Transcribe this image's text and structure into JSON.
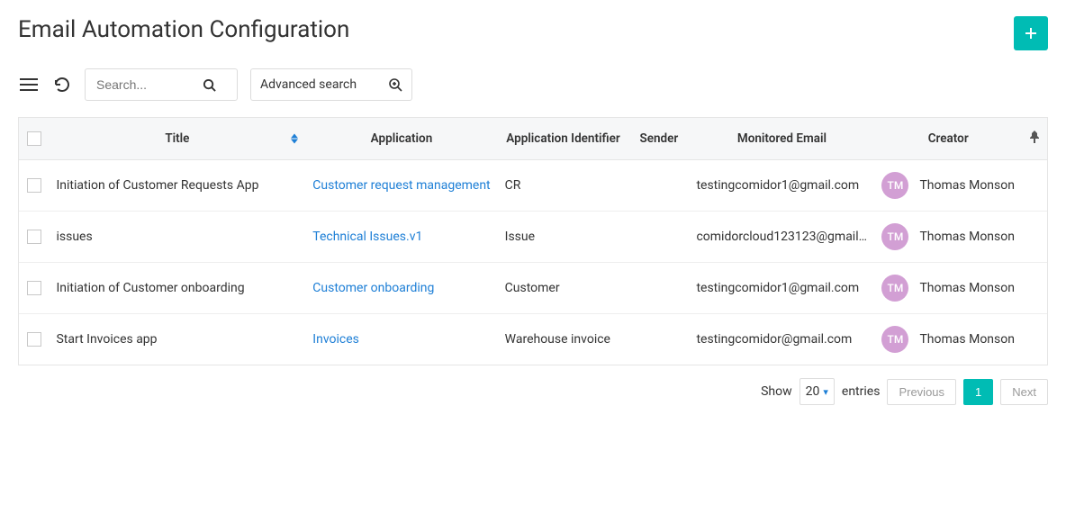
{
  "page": {
    "title": "Email Automation Configuration"
  },
  "toolbar": {
    "search_placeholder": "Search...",
    "advanced_label": "Advanced search"
  },
  "table": {
    "headers": {
      "title": "Title",
      "application": "Application",
      "app_identifier": "Application Identifier",
      "sender": "Sender",
      "monitored_email": "Monitored Email",
      "creator": "Creator"
    },
    "rows": [
      {
        "title": "Initiation of Customer Requests App",
        "application": "Customer request management",
        "app_identifier": "CR",
        "sender": "",
        "monitored_email": "testingcomidor1@gmail.com",
        "creator_initials": "TM",
        "creator_name": "Thomas Monson"
      },
      {
        "title": "issues",
        "application": "Technical Issues.v1",
        "app_identifier": "Issue",
        "sender": "",
        "monitored_email": "comidorcloud123123@gmail.c...",
        "creator_initials": "TM",
        "creator_name": "Thomas Monson"
      },
      {
        "title": "Initiation of Customer onboarding",
        "application": "Customer onboarding",
        "app_identifier": "Customer",
        "sender": "",
        "monitored_email": "testingcomidor1@gmail.com",
        "creator_initials": "TM",
        "creator_name": "Thomas Monson"
      },
      {
        "title": "Start Invoices app",
        "application": "Invoices",
        "app_identifier": "Warehouse invoice",
        "sender": "",
        "monitored_email": "testingcomidor@gmail.com",
        "creator_initials": "TM",
        "creator_name": "Thomas Monson"
      }
    ]
  },
  "pager": {
    "show_label": "Show",
    "page_size": "20",
    "entries_label": "entries",
    "prev_label": "Previous",
    "current_page": "1",
    "next_label": "Next"
  }
}
